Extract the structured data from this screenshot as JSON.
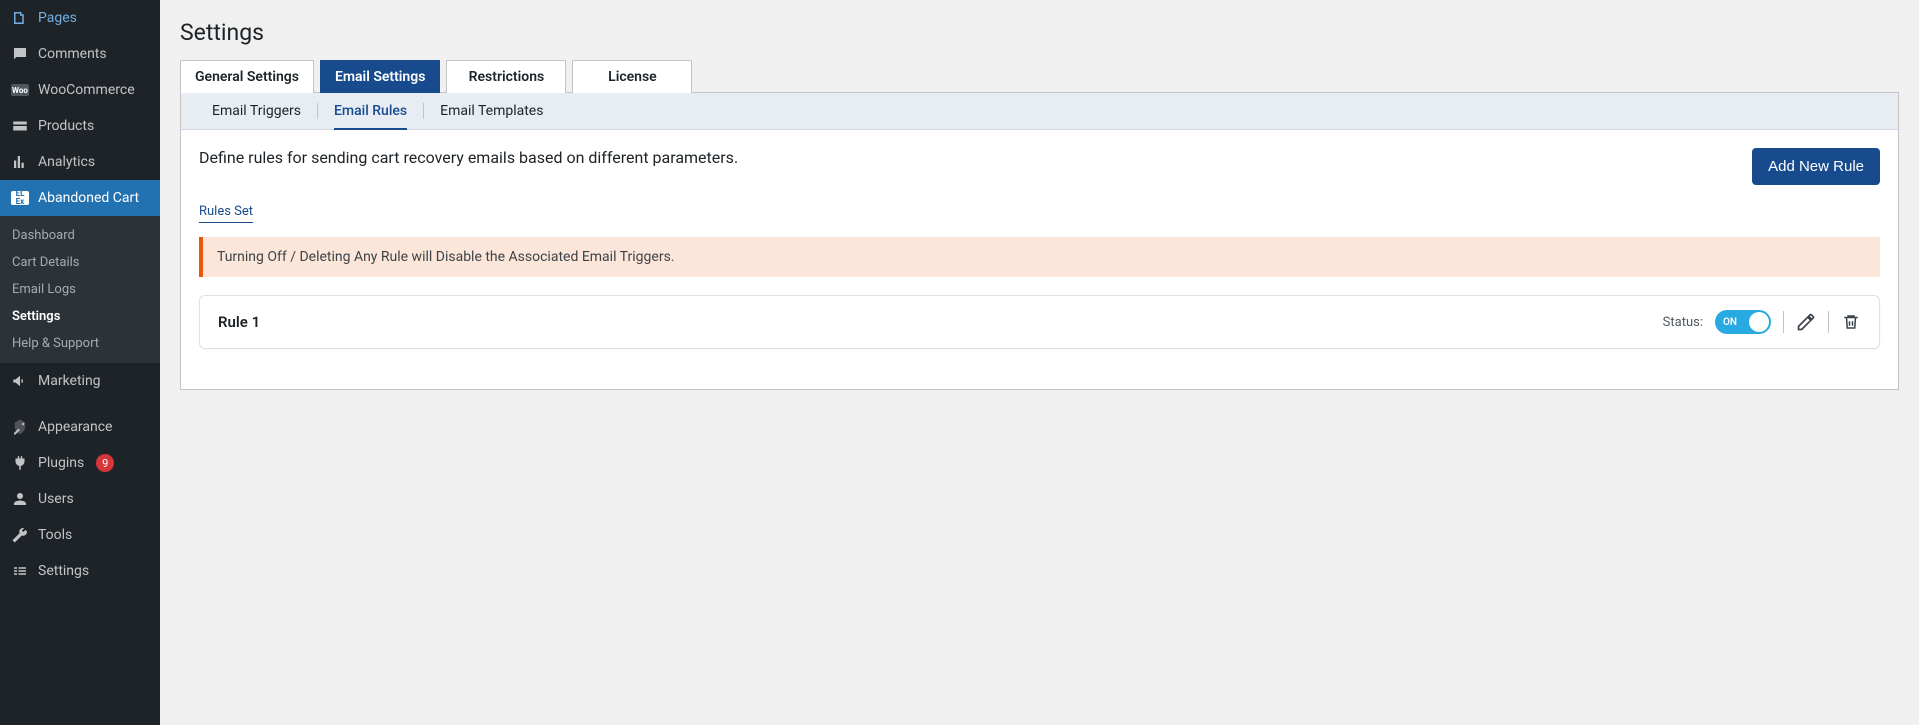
{
  "sidebar": {
    "items": [
      {
        "label": "Pages",
        "icon": "pages"
      },
      {
        "label": "Comments",
        "icon": "comments"
      },
      {
        "label": "WooCommerce",
        "icon": "woo"
      },
      {
        "label": "Products",
        "icon": "products"
      },
      {
        "label": "Analytics",
        "icon": "analytics"
      },
      {
        "label": "Abandoned Cart",
        "icon": "elex"
      },
      {
        "label": "Marketing",
        "icon": "marketing"
      },
      {
        "label": "Appearance",
        "icon": "appearance"
      },
      {
        "label": "Plugins",
        "icon": "plugins",
        "badge": "9"
      },
      {
        "label": "Users",
        "icon": "users"
      },
      {
        "label": "Tools",
        "icon": "tools"
      },
      {
        "label": "Settings",
        "icon": "settings"
      }
    ],
    "sub": [
      {
        "label": "Dashboard"
      },
      {
        "label": "Cart Details"
      },
      {
        "label": "Email Logs"
      },
      {
        "label": "Settings"
      },
      {
        "label": "Help & Support"
      }
    ]
  },
  "page": {
    "title": "Settings"
  },
  "tabs": {
    "items": [
      {
        "label": "General Settings"
      },
      {
        "label": "Email Settings"
      },
      {
        "label": "Restrictions"
      },
      {
        "label": "License"
      }
    ]
  },
  "subtabs": {
    "items": [
      {
        "label": "Email Triggers"
      },
      {
        "label": "Email Rules"
      },
      {
        "label": "Email Templates"
      }
    ]
  },
  "content": {
    "description": "Define rules for sending cart recovery emails based on different parameters.",
    "add_button": "Add New Rule",
    "section_label": "Rules Set",
    "alert_text": "Turning Off / Deleting Any Rule will Disable the Associated Email Triggers.",
    "rule": {
      "name": "Rule 1",
      "status_label": "Status:",
      "toggle_text": "ON"
    }
  }
}
